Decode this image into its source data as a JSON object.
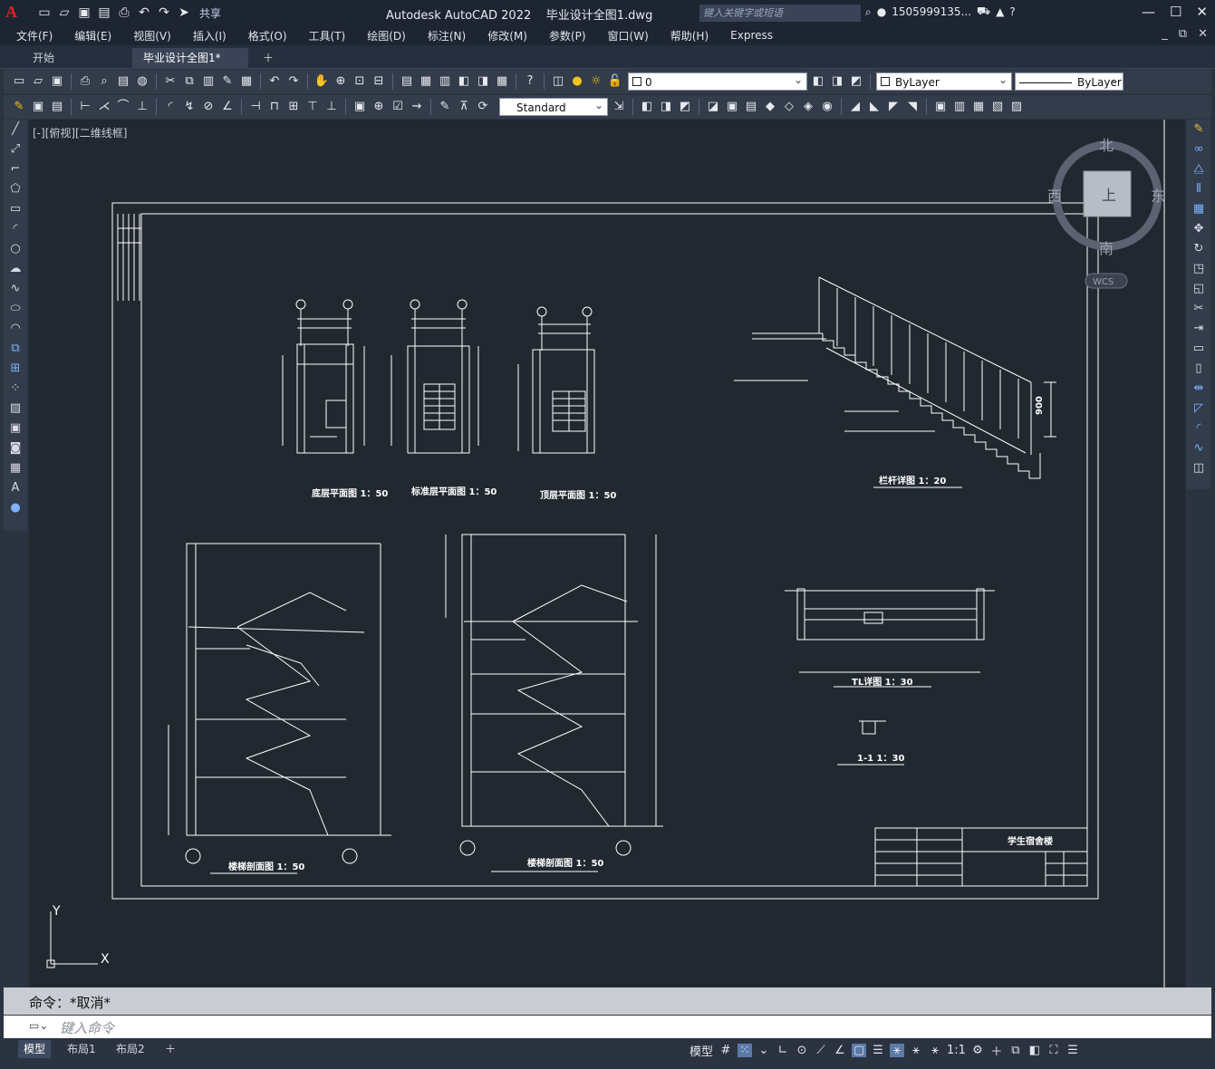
{
  "titlebar": {
    "app_title": "Autodesk AutoCAD 2022",
    "doc_title": "毕业设计全图1.dwg",
    "share_label": "共享",
    "search_placeholder": "键入关键字或短语",
    "user": "1505999135...",
    "icons": [
      "new-icon",
      "open-icon",
      "save-icon",
      "saveas-icon",
      "plot-icon",
      "undo-icon",
      "redo-icon"
    ]
  },
  "menu": [
    "文件(F)",
    "编辑(E)",
    "视图(V)",
    "插入(I)",
    "格式(O)",
    "工具(T)",
    "绘图(D)",
    "标注(N)",
    "修改(M)",
    "参数(P)",
    "窗口(W)",
    "帮助(H)",
    "Express"
  ],
  "tabs": [
    {
      "label": "开始"
    },
    {
      "label": "毕业设计全图1*"
    }
  ],
  "toolbar": {
    "layer_value": "0",
    "color_value": "ByLayer",
    "linetype_value": "ByLayer",
    "textstyle_value": "Standard"
  },
  "viewport": {
    "label": "[-][俯视][二维线框]",
    "viewcube": {
      "north": "北",
      "south": "南",
      "east": "东",
      "west": "西",
      "face": "上",
      "wcs": "WCS"
    },
    "ucs": {
      "x": "X",
      "y": "Y"
    }
  },
  "drawing": {
    "plan1_title": "底层平面图 1：50",
    "plan2_title": "标准层平面图 1：50",
    "plan3_title": "顶层平面图 1：50",
    "section1_title": "楼梯剖面图 1：50",
    "section2_title": "楼梯剖面图 1：50",
    "railing_title": "栏杆详图 1：20",
    "beam_title": "TL详图 1：30",
    "detail_title": "1-1 1：30",
    "railing_height": "900",
    "title_block_name": "学生宿舍楼"
  },
  "command": {
    "history": "命令：*取消*",
    "placeholder": "键入命令"
  },
  "status": {
    "layouts": [
      "模型",
      "布局1",
      "布局2"
    ],
    "model_label": "模型",
    "scale": "1:1"
  }
}
